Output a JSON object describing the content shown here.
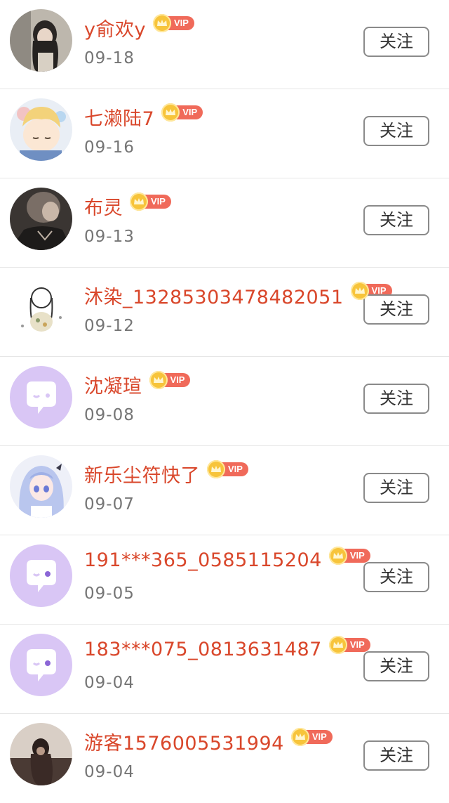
{
  "users": [
    {
      "name": "y俞欢y",
      "date": "09-18",
      "vip": "VIP",
      "follow": "关注",
      "avatar": "photo-girl-icon"
    },
    {
      "name": "七濑陆7",
      "date": "09-16",
      "vip": "VIP",
      "follow": "关注",
      "avatar": "anime-boy-icon"
    },
    {
      "name": "布灵",
      "date": "09-13",
      "vip": "VIP",
      "follow": "关注",
      "avatar": "photo-dark-icon"
    },
    {
      "name": "沐染_13285303478482051",
      "date": "09-12",
      "vip": "VIP",
      "follow": "关注",
      "avatar": "sketch-girl-icon"
    },
    {
      "name": "沈凝瑄",
      "date": "09-08",
      "vip": "VIP",
      "follow": "关注",
      "avatar": "default-chat-icon"
    },
    {
      "name": "新乐尘符快了",
      "date": "09-07",
      "vip": "VIP",
      "follow": "关注",
      "avatar": "anime-girl-icon"
    },
    {
      "name": "191***365_0585115204",
      "date": "09-05",
      "vip": "VIP",
      "follow": "关注",
      "avatar": "default-chat-icon"
    },
    {
      "name": "183***075_0813631487",
      "date": "09-04",
      "vip": "VIP",
      "follow": "关注",
      "avatar": "default-chat-icon"
    },
    {
      "name": "游客1576005531994",
      "date": "09-04",
      "vip": "VIP",
      "follow": "关注",
      "avatar": "photo-sunset-icon"
    }
  ],
  "colors": {
    "name": "#d9472b",
    "vip_pill": "#f06a5a",
    "crown": "#f7c43b",
    "default_avatar": "#d9c6f5"
  }
}
